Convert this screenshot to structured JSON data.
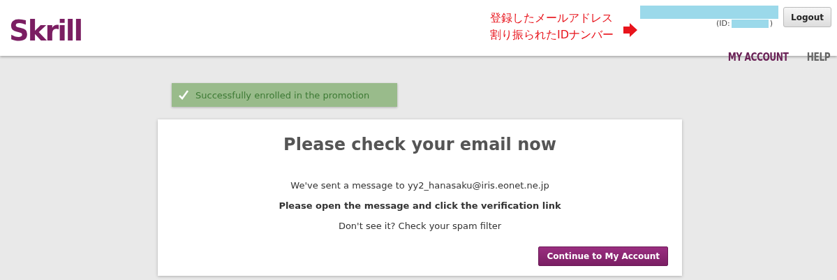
{
  "header": {
    "logo": "Skrill",
    "annotation": {
      "lines": [
        "登録したメールアドレス",
        "割り振られたIDナンバー"
      ]
    },
    "account": {
      "id_prefix": "(ID:",
      "id_suffix": ")"
    },
    "logout": "Logout",
    "nav": [
      {
        "label": "MY ACCOUNT",
        "selected": true
      },
      {
        "label": "HELP",
        "selected": false
      }
    ]
  },
  "alert": {
    "message": "Successfully enrolled in the promotion"
  },
  "card": {
    "title": "Please check your email now",
    "lines": [
      {
        "text": "We've sent a message to yy2_hanasaku@iris.eonet.ne.jp",
        "kind": "normal"
      },
      {
        "text": "Please open the message and click the verification link",
        "kind": "bold"
      },
      {
        "text": "Don't see it? Check your spam filter",
        "kind": "normal"
      }
    ],
    "button": "Continue to My Account"
  }
}
